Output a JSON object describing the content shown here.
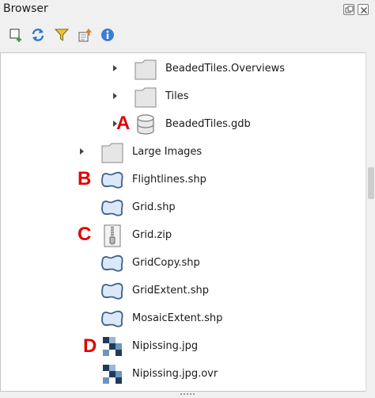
{
  "panel": {
    "title": "Browser"
  },
  "toolbar": {
    "buttons": [
      {
        "name": "add-layer-icon"
      },
      {
        "name": "refresh-icon"
      },
      {
        "name": "filter-icon"
      },
      {
        "name": "collapse-all-icon"
      },
      {
        "name": "info-icon"
      }
    ]
  },
  "tree": {
    "items": [
      {
        "label": "BeadedTiles.Overviews",
        "icon": "folder-icon",
        "expandable": true
      },
      {
        "label": "Tiles",
        "icon": "folder-icon",
        "expandable": true
      },
      {
        "label": "BeadedTiles.gdb",
        "icon": "database-icon",
        "expandable": true
      },
      {
        "label": "Large Images",
        "icon": "folder-icon",
        "expandable": true
      },
      {
        "label": "Flightlines.shp",
        "icon": "vector-layer-icon",
        "expandable": false
      },
      {
        "label": "Grid.shp",
        "icon": "vector-layer-icon",
        "expandable": false
      },
      {
        "label": "Grid.zip",
        "icon": "zip-archive-icon",
        "expandable": false
      },
      {
        "label": "GridCopy.shp",
        "icon": "vector-layer-icon",
        "expandable": false
      },
      {
        "label": "GridExtent.shp",
        "icon": "vector-layer-icon",
        "expandable": false
      },
      {
        "label": "MosaicExtent.shp",
        "icon": "vector-layer-icon",
        "expandable": false
      },
      {
        "label": "Nipissing.jpg",
        "icon": "raster-layer-icon",
        "expandable": false
      },
      {
        "label": "Nipissing.jpg.ovr",
        "icon": "raster-layer-icon",
        "expandable": false
      }
    ]
  },
  "markers": {
    "a": "A",
    "b": "B",
    "c": "C",
    "d": "D"
  },
  "colors": {
    "marker": "#e00000",
    "vector_fill": "#dbe8f7",
    "vector_stroke": "#3c5f8c"
  }
}
